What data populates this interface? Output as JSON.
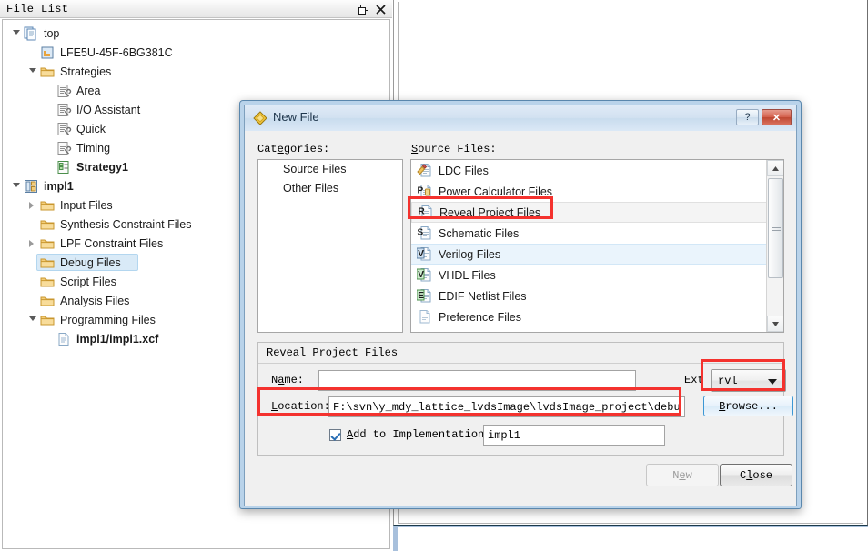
{
  "file_list_panel": {
    "title": "File List",
    "buttons": [
      {
        "name": "float-panel-button",
        "icon": "float-icon"
      },
      {
        "name": "close-panel-button",
        "icon": "close-icon"
      }
    ],
    "tree": [
      {
        "label": "top",
        "indent": 0,
        "toggle": "expanded",
        "icon": "project-icon",
        "bold": false,
        "selected": false
      },
      {
        "label": "LFE5U-45F-6BG381C",
        "indent": 1,
        "toggle": "none",
        "icon": "device-icon",
        "bold": false,
        "selected": false
      },
      {
        "label": "Strategies",
        "indent": 1,
        "toggle": "expanded",
        "icon": "folder-icon",
        "bold": false,
        "selected": false
      },
      {
        "label": "Area",
        "indent": 2,
        "toggle": "none",
        "icon": "strategy-icon",
        "bold": false,
        "selected": false
      },
      {
        "label": "I/O Assistant",
        "indent": 2,
        "toggle": "none",
        "icon": "strategy-icon",
        "bold": false,
        "selected": false
      },
      {
        "label": "Quick",
        "indent": 2,
        "toggle": "none",
        "icon": "strategy-icon",
        "bold": false,
        "selected": false
      },
      {
        "label": "Timing",
        "indent": 2,
        "toggle": "none",
        "icon": "strategy-icon",
        "bold": false,
        "selected": false
      },
      {
        "label": "Strategy1",
        "indent": 2,
        "toggle": "none",
        "icon": "strategy-active-icon",
        "bold": true,
        "selected": false
      },
      {
        "label": "impl1",
        "indent": 0,
        "toggle": "expanded",
        "icon": "impl-icon",
        "bold": true,
        "selected": false
      },
      {
        "label": "Input Files",
        "indent": 1,
        "toggle": "collapsed",
        "icon": "folder-icon",
        "bold": false,
        "selected": false
      },
      {
        "label": "Synthesis Constraint Files",
        "indent": 1,
        "toggle": "none",
        "icon": "folder-icon",
        "bold": false,
        "selected": false
      },
      {
        "label": "LPF Constraint Files",
        "indent": 1,
        "toggle": "collapsed",
        "icon": "folder-icon",
        "bold": false,
        "selected": false
      },
      {
        "label": "Debug Files",
        "indent": 1,
        "toggle": "none",
        "icon": "folder-icon",
        "bold": false,
        "selected": true
      },
      {
        "label": "Script Files",
        "indent": 1,
        "toggle": "none",
        "icon": "folder-icon",
        "bold": false,
        "selected": false
      },
      {
        "label": "Analysis Files",
        "indent": 1,
        "toggle": "none",
        "icon": "folder-icon",
        "bold": false,
        "selected": false
      },
      {
        "label": "Programming Files",
        "indent": 1,
        "toggle": "expanded",
        "icon": "folder-icon",
        "bold": false,
        "selected": false
      },
      {
        "label": "impl1/impl1.xcf",
        "indent": 2,
        "toggle": "none",
        "icon": "file-icon",
        "bold": true,
        "selected": false
      }
    ]
  },
  "dialog": {
    "title": "New File",
    "icon": "new-file-diamond-icon",
    "help_label": "?",
    "close_label": "✕",
    "categories_label": "Categories:",
    "categories": [
      {
        "label": "Source Files"
      },
      {
        "label": "Other Files"
      }
    ],
    "source_files_label": "Source Files:",
    "source_files": [
      {
        "label": "LDC Files",
        "icon": "ldc-file-icon",
        "state": "normal"
      },
      {
        "label": "Power Calculator Files",
        "icon": "power-file-icon",
        "state": "normal"
      },
      {
        "label": "Reveal Project Files",
        "icon": "reveal-file-icon",
        "state": "focusrow"
      },
      {
        "label": "Schematic Files",
        "icon": "schematic-file-icon",
        "state": "normal"
      },
      {
        "label": "Verilog Files",
        "icon": "verilog-file-icon",
        "state": "hover"
      },
      {
        "label": "VHDL Files",
        "icon": "vhdl-file-icon",
        "state": "normal"
      },
      {
        "label": "EDIF Netlist Files",
        "icon": "edif-file-icon",
        "state": "normal"
      },
      {
        "label": "Preference Files",
        "icon": "preference-file-icon",
        "state": "normal"
      }
    ],
    "group": {
      "title": "Reveal Project Files",
      "name_label": "Name:",
      "name_value": "",
      "ext_label": "Ext",
      "ext_value": "rvl",
      "location_label": "Location:",
      "location_value": "F:\\svn\\y_mdy_lattice_lvdsImage\\lvdsImage_project\\debug",
      "browse_label": "Browse...",
      "add_to_impl_label": "Add to Implementation",
      "add_to_impl_checked": true,
      "impl_value": "impl1"
    },
    "buttons": {
      "new_label": "New",
      "new_enabled": false,
      "close_label": "Close"
    }
  },
  "annotations": {
    "highlight_color": "#f4322e",
    "boxes": [
      {
        "name": "reveal-project-files-highlight"
      },
      {
        "name": "ext-dropdown-highlight"
      },
      {
        "name": "location-field-highlight"
      }
    ]
  }
}
